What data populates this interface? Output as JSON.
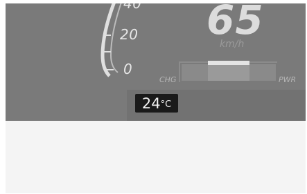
{
  "gauge": {
    "ticks": [
      "40",
      "20",
      "0"
    ]
  },
  "speedometer": {
    "value": "65",
    "unit": "km/h"
  },
  "power_meter": {
    "left_label": "CHG",
    "right_label": "PWR"
  },
  "temperature": {
    "value": "24",
    "unit": "°C"
  },
  "colors": {
    "panel": "#7a7a7a",
    "speed_text": "#dcdcdc",
    "temp_badge": "#1a1a1a"
  }
}
